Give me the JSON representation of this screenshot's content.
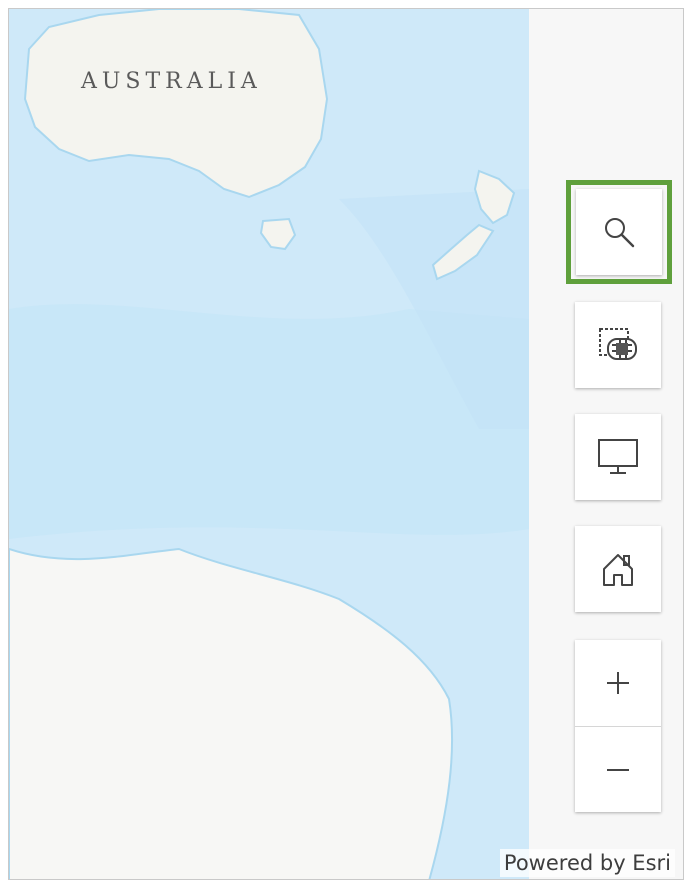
{
  "map": {
    "label": "AUSTRALIA",
    "attribution": "Powered by Esri",
    "colors": {
      "ocean": "#cfe9f9",
      "ocean_deep": "#bfe2f7",
      "land": "#f4f4ef",
      "coast": "#9fd3ee"
    }
  },
  "widgets": {
    "search": {
      "icon": "search-icon",
      "active": true,
      "highlight_color": "#5fa03c"
    },
    "basemap": {
      "icon": "basemap-gallery-icon"
    },
    "fullscreen": {
      "icon": "monitor-icon"
    },
    "home": {
      "icon": "home-icon"
    },
    "zoom_in": {
      "icon": "plus-icon"
    },
    "zoom_out": {
      "icon": "minus-icon"
    }
  }
}
